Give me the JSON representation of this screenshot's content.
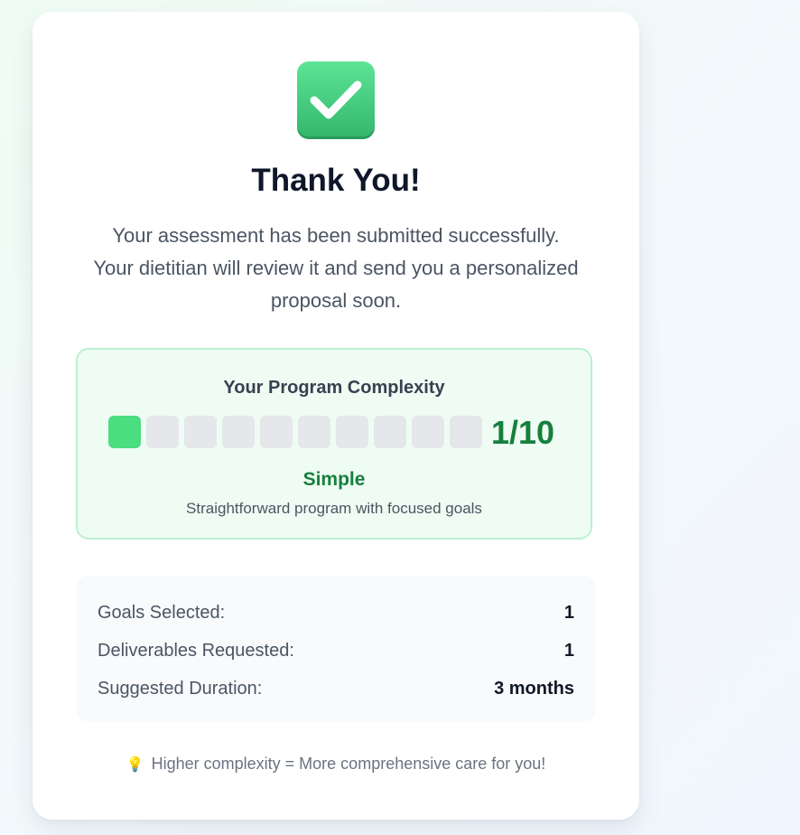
{
  "header": {
    "icon": "check-mark-icon",
    "title": "Thank You!",
    "message": "Your assessment has been submitted successfully. Your dietitian will review it and send you a personalized proposal soon."
  },
  "complexity": {
    "title": "Your Program Complexity",
    "score": 1,
    "max": 10,
    "score_label": "1/10",
    "level": "Simple",
    "description": "Straightforward program with focused goals",
    "filled_color": "#4ade80",
    "empty_color": "#e5e7eb",
    "accent_color": "#15803d"
  },
  "summary": {
    "rows": [
      {
        "label": "Goals Selected:",
        "value": "1"
      },
      {
        "label": "Deliverables Requested:",
        "value": "1"
      },
      {
        "label": "Suggested Duration:",
        "value": "3 months"
      }
    ]
  },
  "footer": {
    "icon": "lightbulb-icon",
    "tip": "Higher complexity = More comprehensive care for you!"
  }
}
